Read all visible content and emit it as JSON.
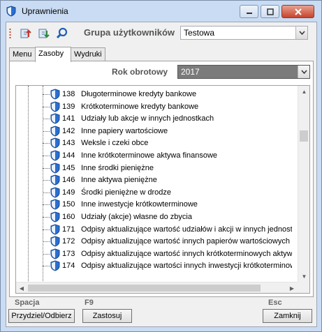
{
  "window": {
    "title": "Uprawnienia",
    "accent": "#c9dcf3"
  },
  "toolbar": {
    "icons": [
      "assign-up-icon",
      "assign-down-icon",
      "search-icon"
    ],
    "group_label": "Grupa użytkowników",
    "group_value": "Testowa"
  },
  "tabs": [
    {
      "label": "Menu"
    },
    {
      "label": "Zasoby"
    },
    {
      "label": "Wydruki"
    }
  ],
  "active_tab": "Zasoby",
  "panel": {
    "rok_label": "Rok obrotowy",
    "rok_value": "2017"
  },
  "items": [
    {
      "num": "138",
      "name": "Długoterminowe kredyty bankowe"
    },
    {
      "num": "139",
      "name": "Krótkoterminowe kredyty bankowe"
    },
    {
      "num": "141",
      "name": "Udziały lub akcje w innych jednostkach"
    },
    {
      "num": "142",
      "name": "Inne papiery wartościowe"
    },
    {
      "num": "143",
      "name": "Weksle i czeki obce"
    },
    {
      "num": "144",
      "name": "Inne krótkoterminowe aktywa finansowe"
    },
    {
      "num": "145",
      "name": "Inne środki pieniężne"
    },
    {
      "num": "146",
      "name": "Inne aktywa pieniężne"
    },
    {
      "num": "149",
      "name": "Środki pieniężne w drodze"
    },
    {
      "num": "150",
      "name": "Inne inwestycje krótkowterminowe"
    },
    {
      "num": "160",
      "name": "Udziały (akcje) własne do zbycia"
    },
    {
      "num": "171",
      "name": "Odpisy aktualizujące wartość udziałów i akcji w innych jednostka"
    },
    {
      "num": "172",
      "name": "Odpisy aktualizujące wartość innych papierów wartościowych"
    },
    {
      "num": "173",
      "name": "Odpisy aktualizujące wartość innych krótkoterminowych aktywów"
    },
    {
      "num": "174",
      "name": "Odpisy aktualizujące wartości innych inwestycji krótkoterminowyc"
    }
  ],
  "bottom": {
    "hint1": "Spacja",
    "btn1": "Przydziel/Odbierz",
    "hint2": "F9",
    "btn2": "Zastosuj",
    "hint3": "Esc",
    "btn3": "Zamknij"
  }
}
